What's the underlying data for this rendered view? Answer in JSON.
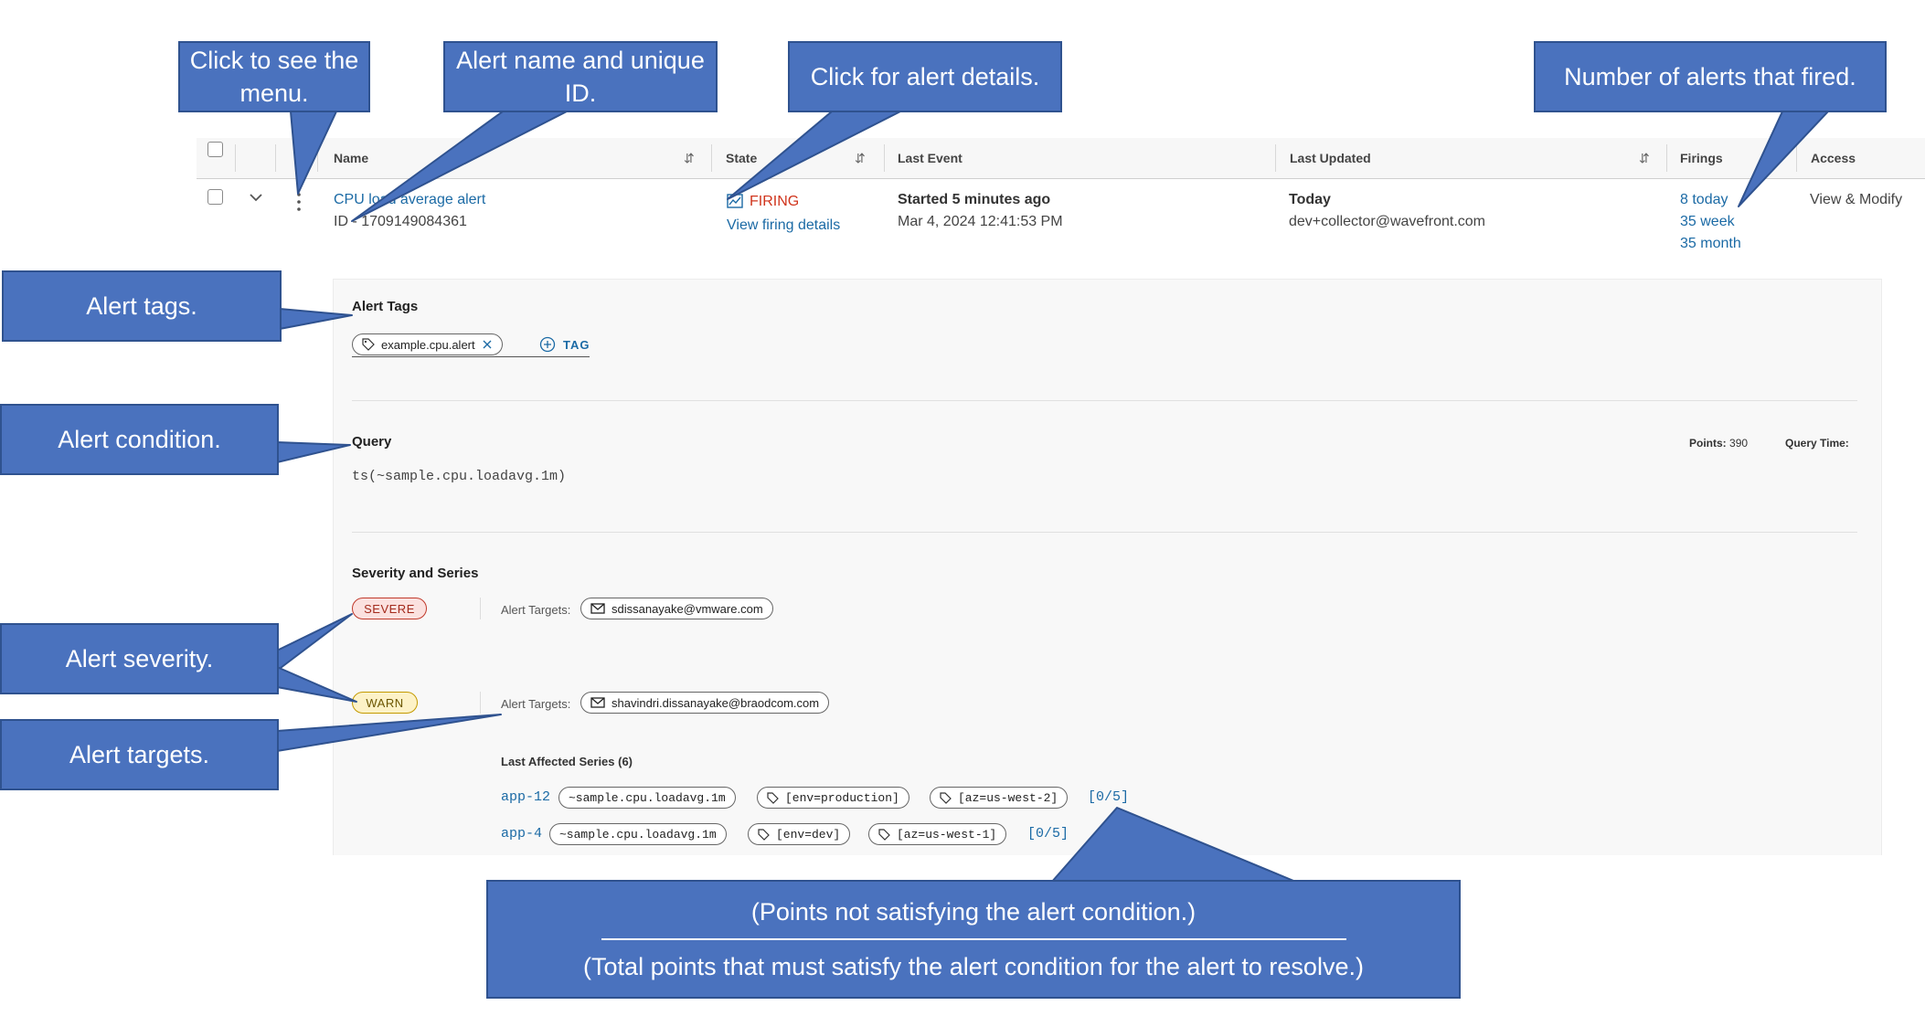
{
  "table": {
    "columns": {
      "name": "Name",
      "state": "State",
      "last_event": "Last Event",
      "last_updated": "Last Updated",
      "firings": "Firings",
      "access": "Access"
    },
    "sort_glyph": "⇵",
    "row": {
      "name": "CPU load average alert",
      "id": "ID - 1709149084361",
      "state": "FIRING",
      "state_link": "View firing details",
      "last_event_title": "Started 5 minutes ago",
      "last_event_time": "Mar 4, 2024 12:41:53 PM",
      "last_updated_title": "Today",
      "last_updated_user": "dev+collector@wavefront.com",
      "firings": [
        "8 today",
        "35 week",
        "35 month"
      ],
      "access": "View & Modify"
    }
  },
  "details": {
    "tags_heading": "Alert Tags",
    "tag": "example.cpu.alert",
    "add_tag": "TAG",
    "query_heading": "Query",
    "points_label": "Points:",
    "points_value": "390",
    "query_time_label": "Query Time:",
    "query": "ts(~sample.cpu.loadavg.1m)",
    "severity_heading": "Severity and Series",
    "severe_label": "SEVERE",
    "warn_label": "WARN",
    "targets_label": "Alert Targets:",
    "severe_target": "sdissanayake@vmware.com",
    "warn_target": "shavindri.dissanayake@braodcom.com",
    "affected_heading": "Last Affected Series (6)",
    "series": [
      {
        "source": "app-12",
        "metric": "~sample.cpu.loadavg.1m",
        "tag1": "[env=production]",
        "tag2": "[az=us-west-2]",
        "ratio": "[0/5]"
      },
      {
        "source": "app-4",
        "metric": "~sample.cpu.loadavg.1m",
        "tag1": "[env=dev]",
        "tag2": "[az=us-west-1]",
        "ratio": "[0/5]"
      }
    ]
  },
  "callouts": {
    "menu": "Click to see the menu.",
    "name": "Alert name and unique ID.",
    "details": "Click for alert details.",
    "firings": "Number of alerts that fired.",
    "tags": "Alert tags.",
    "condition": "Alert condition.",
    "severity": "Alert severity.",
    "targets": "Alert targets.",
    "points_not": "(Points not satisfying the alert condition.)",
    "points_total": "(Total points that must satisfy the alert condition for the alert to resolve.)"
  },
  "colors": {
    "link": "#1b6aa5",
    "firing": "#d0341c",
    "callout": "#4a72be",
    "severe_bg": "#fbe1df",
    "warn_bg": "#fdf2c7"
  }
}
